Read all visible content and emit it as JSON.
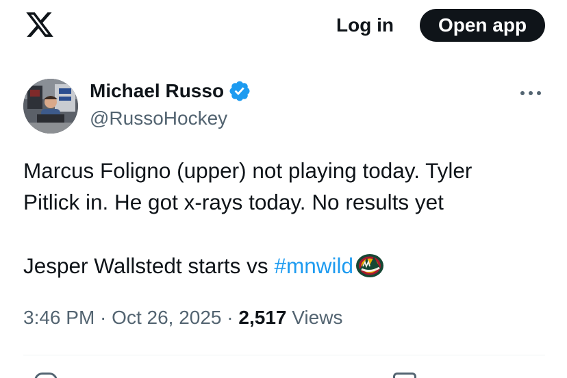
{
  "topbar": {
    "logo_icon": "x-logo-icon",
    "login_label": "Log in",
    "open_app_label": "Open app"
  },
  "author": {
    "name": "Michael Russo",
    "handle": "@RussoHockey",
    "verified_icon": "verified-badge-icon",
    "verified_color": "#1d9bf0"
  },
  "tweet": {
    "line1": "Marcus Foligno (upper) not playing today. Tyler",
    "line2": "Pitlick in. He got x-rays today. No results yet",
    "line3_text": "Jesper Wallstedt starts vs ",
    "hashtag": "#mnwild",
    "hashtag_color": "#1d9bf0",
    "emoji_icon": "minnesota-wild-logo-icon"
  },
  "meta": {
    "time": "3:46 PM",
    "sep1": " · ",
    "date": "Oct 26, 2025",
    "sep2": " · ",
    "views_count": "2,517",
    "views_label": " Views"
  },
  "colors": {
    "text_primary": "#0f1419",
    "text_secondary": "#536471",
    "accent": "#1d9bf0"
  }
}
